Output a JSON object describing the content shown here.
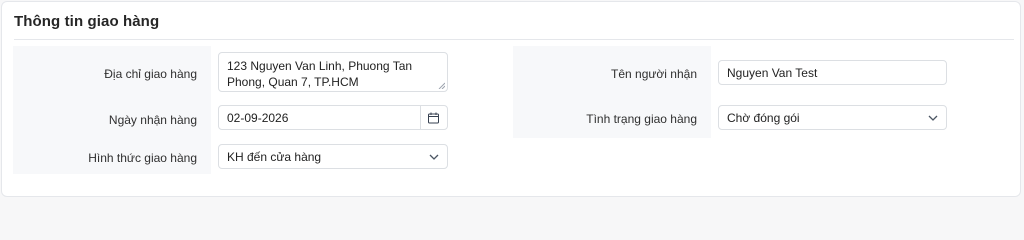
{
  "section": {
    "title": "Thông tin giao hàng"
  },
  "fields": {
    "address": {
      "label": "Địa chỉ giao hàng",
      "value": "123 Nguyen Van Linh, Phuong Tan Phong, Quan 7, TP.HCM"
    },
    "delivery_date": {
      "label": "Ngày nhận hàng",
      "value": "02-09-2026",
      "icon": "calendar-icon"
    },
    "delivery_method": {
      "label": "Hình thức giao hàng",
      "selected": "KH đến cửa hàng",
      "icon": "chevron-down-icon"
    },
    "recipient": {
      "label": "Tên người nhận",
      "value": "Nguyen Van Test"
    },
    "status": {
      "label": "Tình trạng giao hàng",
      "selected": "Chờ đóng gói",
      "icon": "chevron-down-icon"
    }
  }
}
